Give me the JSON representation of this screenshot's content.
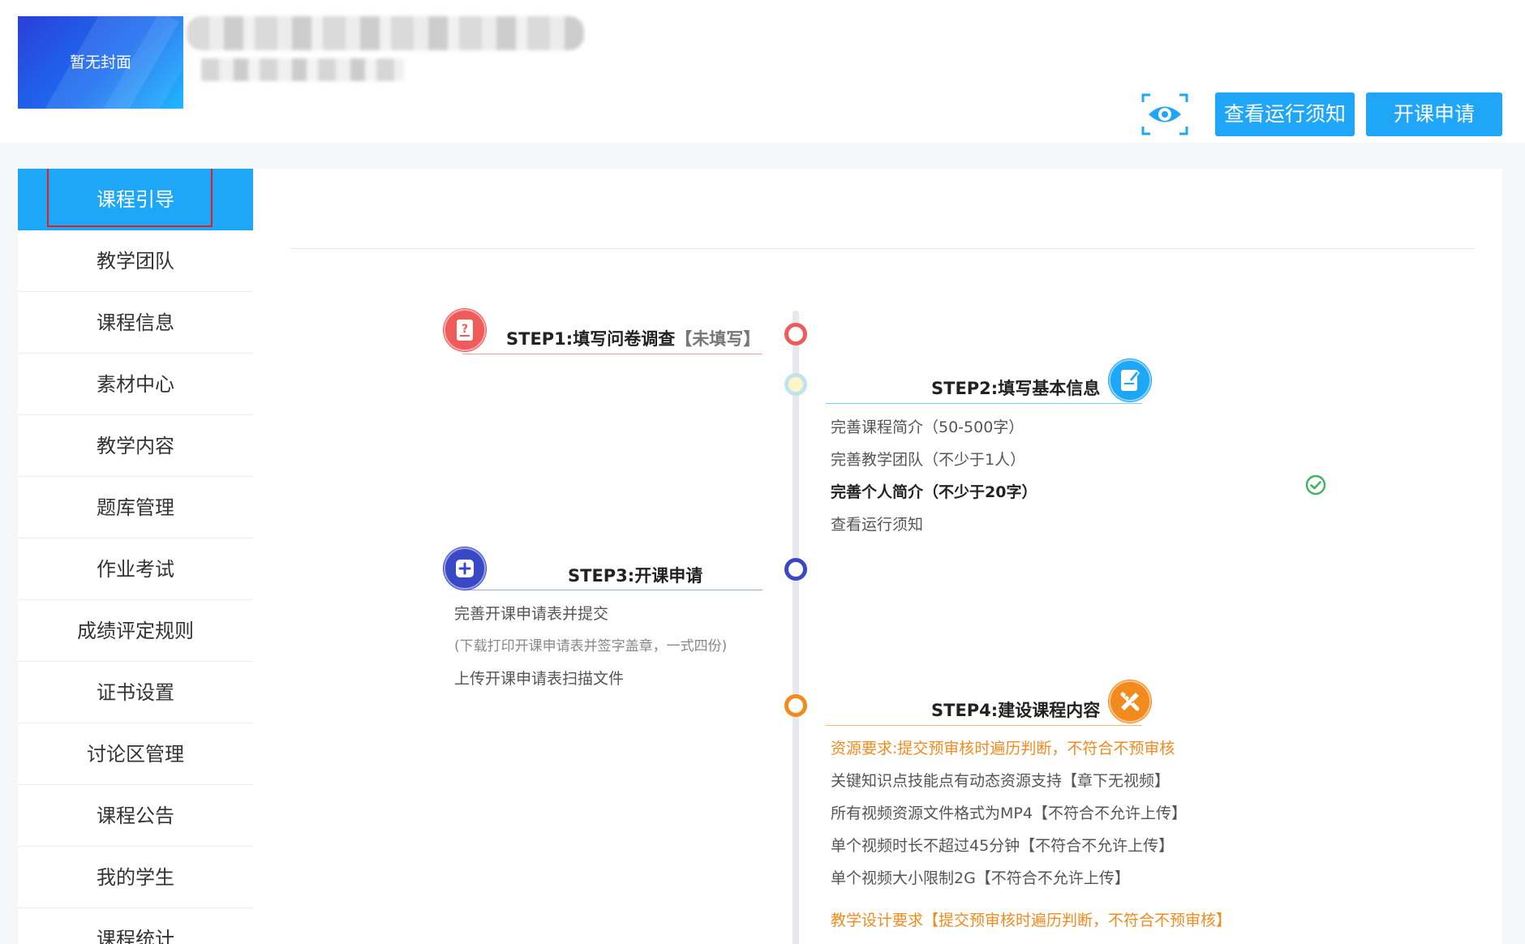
{
  "header": {
    "cover_text": "暂无封面",
    "buttons": {
      "preview_icon": "eye-icon",
      "notice_label": "查看运行须知",
      "apply_label": "开课申请"
    }
  },
  "sidebar": {
    "items": [
      {
        "label": "课程引导"
      },
      {
        "label": "教学团队"
      },
      {
        "label": "课程信息"
      },
      {
        "label": "素材中心"
      },
      {
        "label": "教学内容"
      },
      {
        "label": "题库管理"
      },
      {
        "label": "作业考试"
      },
      {
        "label": "成绩评定规则"
      },
      {
        "label": "证书设置"
      },
      {
        "label": "讨论区管理"
      },
      {
        "label": "课程公告"
      },
      {
        "label": "我的学生"
      },
      {
        "label": "课程统计"
      }
    ]
  },
  "steps": {
    "step1": {
      "title": "STEP1:填写问卷调查",
      "tag": "【未填写】",
      "color": "#ef5b5b",
      "icon": "questionnaire-icon"
    },
    "step2": {
      "title": "STEP2:填写基本信息",
      "color": "#1fa7f7",
      "icon": "edit-document-icon",
      "items": [
        "完善课程简介（50-500字）",
        "完善教学团队（不少于1人）",
        "完善个人简介（不少于20字）",
        "查看运行须知"
      ]
    },
    "step3": {
      "title": "STEP3:开课申请",
      "color": "#3949c6",
      "icon": "apply-form-icon",
      "items": [
        "完善开课申请表并提交",
        "(下载打印开课申请表并签字盖章，一式四份)",
        "上传开课申请表扫描文件"
      ]
    },
    "step4": {
      "title": "STEP4:建设课程内容",
      "color": "#f28a1d",
      "icon": "pencil-ruler-icon",
      "items": [
        "资源要求:提交预审核时遍历判断，不符合不预审核",
        "关键知识点技能点有动态资源支持【章下无视频】",
        "所有视频资源文件格式为MP4【不符合不允许上传】",
        "单个视频时长不超过45分钟【不符合不允许上传】",
        "单个视频大小限制2G【不符合不允许上传】",
        "教学设计要求【提交预审核时遍历判断，不符合不预审核】"
      ]
    }
  }
}
